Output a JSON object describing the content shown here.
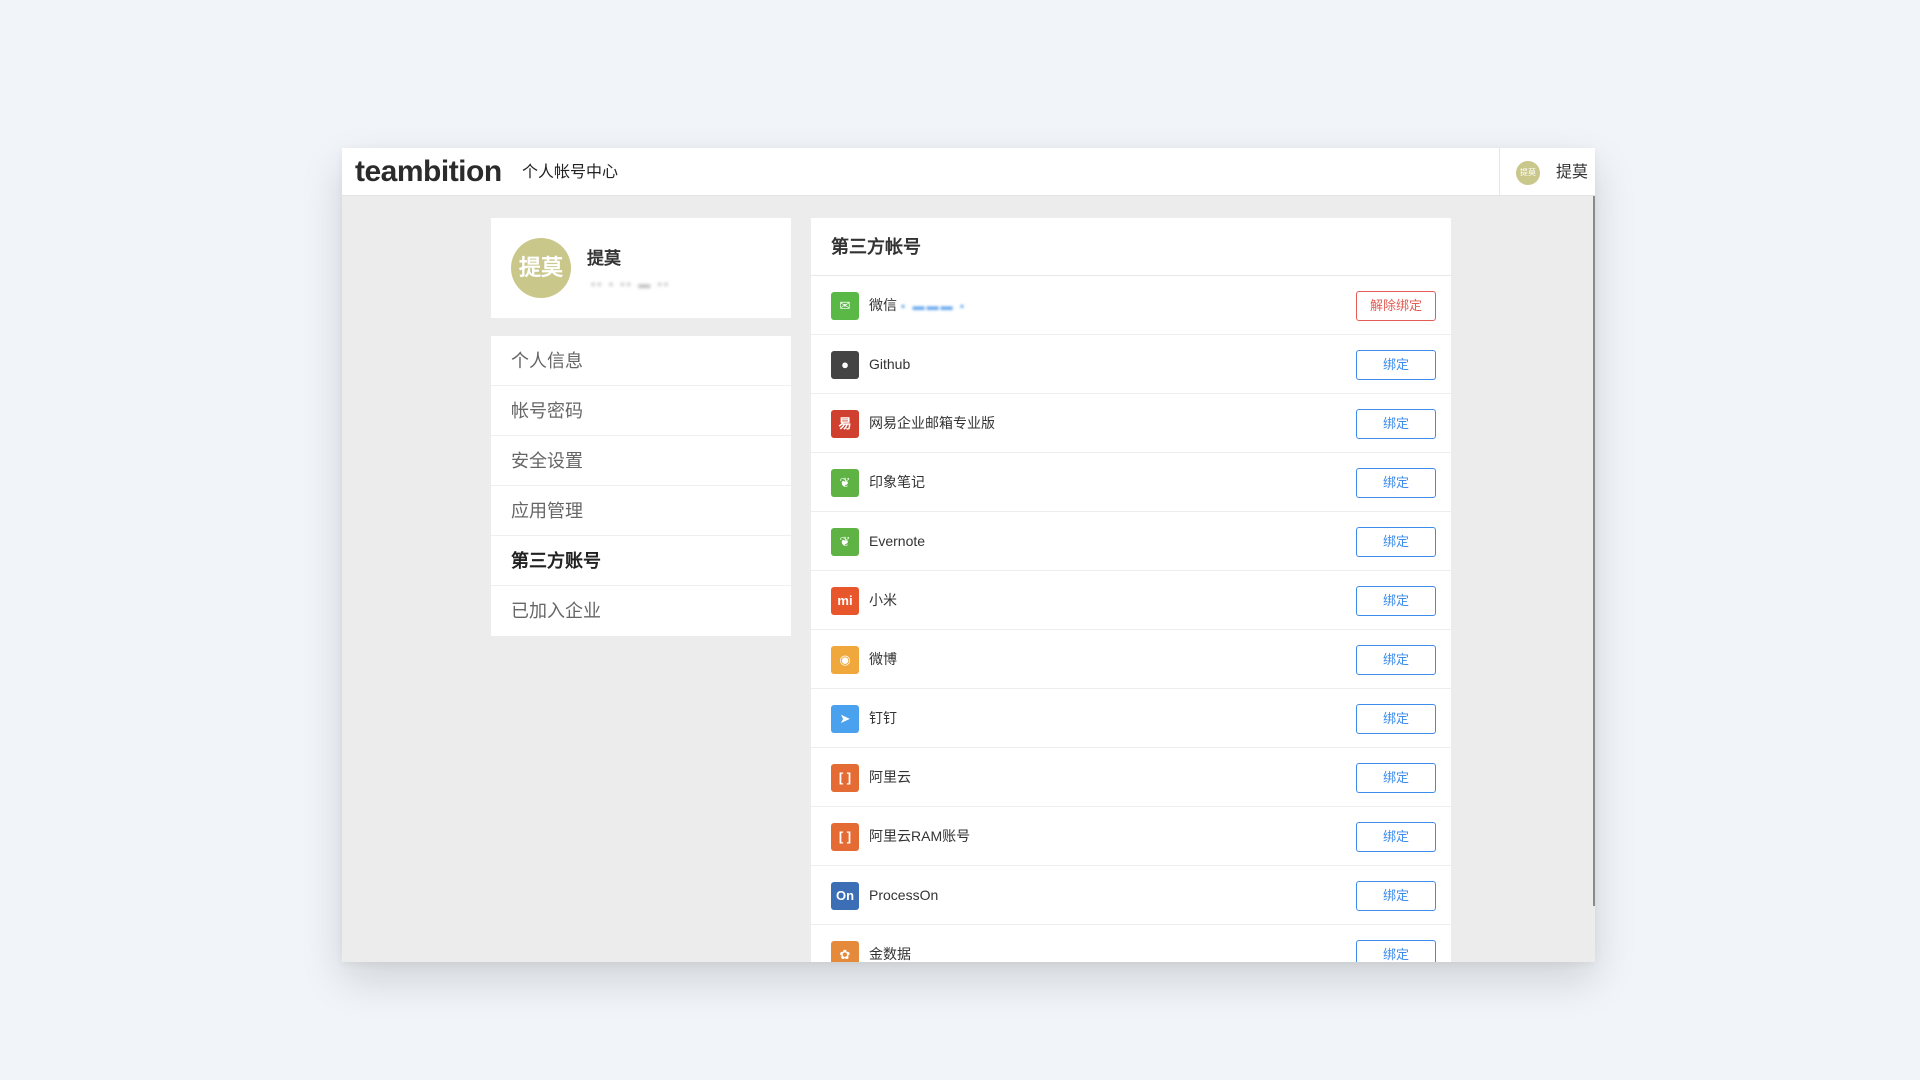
{
  "header": {
    "brand": "teambition",
    "subtitle": "个人帐号中心",
    "user_avatar_text": "提莫",
    "user_name": "提莫"
  },
  "profile": {
    "avatar_text": "提莫",
    "name": "提莫",
    "email_masked": "▪▪ ▪ ▪▪ ▬ ▪▪"
  },
  "sidebar": {
    "items": [
      {
        "label": "个人信息",
        "active": false
      },
      {
        "label": "帐号密码",
        "active": false
      },
      {
        "label": "安全设置",
        "active": false
      },
      {
        "label": "应用管理",
        "active": false
      },
      {
        "label": "第三方账号",
        "active": true
      },
      {
        "label": "已加入企业",
        "active": false
      }
    ]
  },
  "panel": {
    "title": "第三方帐号",
    "accounts": [
      {
        "name": "微信",
        "extra": "▪ ▬▬▬ ▪",
        "button": "解除绑定",
        "icon": "wechat-icon",
        "icon_glyph": "✉",
        "color": "#5ab946"
      },
      {
        "name": "Github",
        "extra": "",
        "button": "绑定",
        "icon": "github-icon",
        "icon_glyph": "●",
        "color": "#444444"
      },
      {
        "name": "网易企业邮箱专业版",
        "extra": "",
        "button": "绑定",
        "icon": "netease-icon",
        "icon_glyph": "易",
        "color": "#d0402f"
      },
      {
        "name": "印象笔记",
        "extra": "",
        "button": "绑定",
        "icon": "yinxiang-icon",
        "icon_glyph": "❦",
        "color": "#5fb244"
      },
      {
        "name": "Evernote",
        "extra": "",
        "button": "绑定",
        "icon": "evernote-icon",
        "icon_glyph": "❦",
        "color": "#5fb244"
      },
      {
        "name": "小米",
        "extra": "",
        "button": "绑定",
        "icon": "xiaomi-icon",
        "icon_glyph": "mi",
        "color": "#e8572c"
      },
      {
        "name": "微博",
        "extra": "",
        "button": "绑定",
        "icon": "weibo-icon",
        "icon_glyph": "◉",
        "color": "#f0a73c"
      },
      {
        "name": "钉钉",
        "extra": "",
        "button": "绑定",
        "icon": "dingtalk-icon",
        "icon_glyph": "➤",
        "color": "#4aa2ee"
      },
      {
        "name": "阿里云",
        "extra": "",
        "button": "绑定",
        "icon": "aliyun-icon",
        "icon_glyph": "[ ]",
        "color": "#e56b35"
      },
      {
        "name": "阿里云RAM账号",
        "extra": "",
        "button": "绑定",
        "icon": "aliyun-ram-icon",
        "icon_glyph": "[ ]",
        "color": "#e56b35"
      },
      {
        "name": "ProcessOn",
        "extra": "",
        "button": "绑定",
        "icon": "processon-icon",
        "icon_glyph": "On",
        "color": "#3b6eb4"
      },
      {
        "name": "金数据",
        "extra": "",
        "button": "绑定",
        "icon": "jinshuju-icon",
        "icon_glyph": "✿",
        "color": "#e58a3a"
      }
    ]
  }
}
